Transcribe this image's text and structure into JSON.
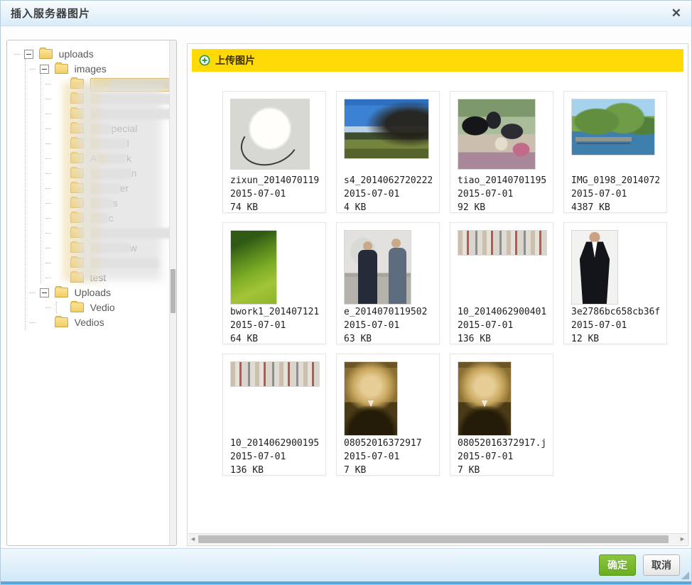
{
  "dialog": {
    "title": "插入服务器图片",
    "close_glyph": "✕"
  },
  "upload_bar": {
    "label": "上传图片",
    "icon": "plus-circle-icon",
    "bg_color": "#ffd905"
  },
  "tree": {
    "nodes": [
      {
        "level": 0,
        "label": "uploads",
        "expander": "minus"
      },
      {
        "level": 1,
        "label": "images",
        "expander": "minus"
      },
      {
        "level": 2,
        "redacted": true,
        "selected": true,
        "blur": 112
      },
      {
        "level": 2,
        "redacted": true,
        "blur": 146
      },
      {
        "level": 2,
        "redacted": true,
        "blur": 136
      },
      {
        "level": 2,
        "redacted": true,
        "blur": 30,
        "post": "pecial"
      },
      {
        "level": 2,
        "redacted": true,
        "blur": 52,
        "post": "l"
      },
      {
        "level": 2,
        "redacted": true,
        "pre": "A",
        "blur": 42,
        "post": "k"
      },
      {
        "level": 2,
        "redacted": true,
        "blur": 58,
        "post": "n"
      },
      {
        "level": 2,
        "redacted": true,
        "blur": 42,
        "post": "er"
      },
      {
        "level": 2,
        "redacted": true,
        "blur": 32,
        "post": "s"
      },
      {
        "level": 2,
        "redacted": true,
        "blur": 26,
        "post": "c"
      },
      {
        "level": 2,
        "redacted": true,
        "blur": 116
      },
      {
        "level": 2,
        "redacted": true,
        "blur": 56,
        "post": "w"
      },
      {
        "level": 2,
        "redacted": true,
        "blur": 96
      },
      {
        "level": 2,
        "label": "test"
      },
      {
        "level": 1,
        "label": "Uploads",
        "expander": "minus"
      },
      {
        "level": 2,
        "label": "Vedio"
      },
      {
        "level": 1,
        "label": "Vedios"
      }
    ]
  },
  "files": [
    {
      "name": "zixun_2014070119",
      "date": "2015-07-01",
      "size": "74 KB",
      "thumb": "lamp"
    },
    {
      "name": "s4_2014062720222",
      "date": "2015-07-01",
      "size": "4 KB",
      "thumb": "landscape"
    },
    {
      "name": "tiao_20140701195",
      "date": "2015-07-01",
      "size": "92 KB",
      "thumb": "crowd"
    },
    {
      "name": "IMG_0198_2014072",
      "date": "2015-07-01",
      "size": "4387 KB",
      "thumb": "mountains"
    },
    {
      "name": "bwork1_201407121",
      "date": "2015-07-01",
      "size": "64 KB",
      "thumb": "ricefield"
    },
    {
      "name": "e_2014070119502",
      "date": "2015-07-01",
      "size": "63 KB",
      "thumb": "twomen"
    },
    {
      "name": "10_2014062900401",
      "date": "2015-07-01",
      "size": "136 KB",
      "thumb": "products"
    },
    {
      "name": "3e2786bc658cb36f",
      "date": "2015-07-01",
      "size": "12 KB",
      "thumb": "tuxedo"
    },
    {
      "name": "10_2014062900195",
      "date": "2015-07-01",
      "size": "136 KB",
      "thumb": "products"
    },
    {
      "name": "08052016372917",
      "date": "2015-07-01",
      "size": "7 KB",
      "thumb": "portrait"
    },
    {
      "name": "08052016372917.j",
      "date": "2015-07-01",
      "size": "7 KB",
      "thumb": "portrait"
    }
  ],
  "footer": {
    "ok_label": "确定",
    "cancel_label": "取消",
    "ok_color": "#6aae21"
  },
  "icons": {
    "left_arrow": "◄",
    "right_arrow": "►"
  }
}
